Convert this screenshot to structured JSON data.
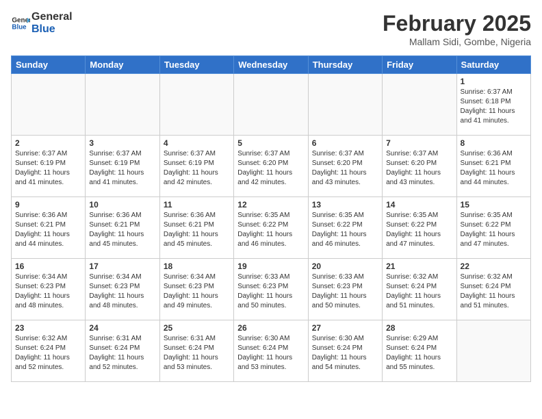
{
  "header": {
    "logo_line1": "General",
    "logo_line2": "Blue",
    "month_title": "February 2025",
    "location": "Mallam Sidi, Gombe, Nigeria"
  },
  "weekdays": [
    "Sunday",
    "Monday",
    "Tuesday",
    "Wednesday",
    "Thursday",
    "Friday",
    "Saturday"
  ],
  "weeks": [
    [
      {
        "day": "",
        "info": ""
      },
      {
        "day": "",
        "info": ""
      },
      {
        "day": "",
        "info": ""
      },
      {
        "day": "",
        "info": ""
      },
      {
        "day": "",
        "info": ""
      },
      {
        "day": "",
        "info": ""
      },
      {
        "day": "1",
        "info": "Sunrise: 6:37 AM\nSunset: 6:18 PM\nDaylight: 11 hours\nand 41 minutes."
      }
    ],
    [
      {
        "day": "2",
        "info": "Sunrise: 6:37 AM\nSunset: 6:19 PM\nDaylight: 11 hours\nand 41 minutes."
      },
      {
        "day": "3",
        "info": "Sunrise: 6:37 AM\nSunset: 6:19 PM\nDaylight: 11 hours\nand 41 minutes."
      },
      {
        "day": "4",
        "info": "Sunrise: 6:37 AM\nSunset: 6:19 PM\nDaylight: 11 hours\nand 42 minutes."
      },
      {
        "day": "5",
        "info": "Sunrise: 6:37 AM\nSunset: 6:20 PM\nDaylight: 11 hours\nand 42 minutes."
      },
      {
        "day": "6",
        "info": "Sunrise: 6:37 AM\nSunset: 6:20 PM\nDaylight: 11 hours\nand 43 minutes."
      },
      {
        "day": "7",
        "info": "Sunrise: 6:37 AM\nSunset: 6:20 PM\nDaylight: 11 hours\nand 43 minutes."
      },
      {
        "day": "8",
        "info": "Sunrise: 6:36 AM\nSunset: 6:21 PM\nDaylight: 11 hours\nand 44 minutes."
      }
    ],
    [
      {
        "day": "9",
        "info": "Sunrise: 6:36 AM\nSunset: 6:21 PM\nDaylight: 11 hours\nand 44 minutes."
      },
      {
        "day": "10",
        "info": "Sunrise: 6:36 AM\nSunset: 6:21 PM\nDaylight: 11 hours\nand 45 minutes."
      },
      {
        "day": "11",
        "info": "Sunrise: 6:36 AM\nSunset: 6:21 PM\nDaylight: 11 hours\nand 45 minutes."
      },
      {
        "day": "12",
        "info": "Sunrise: 6:35 AM\nSunset: 6:22 PM\nDaylight: 11 hours\nand 46 minutes."
      },
      {
        "day": "13",
        "info": "Sunrise: 6:35 AM\nSunset: 6:22 PM\nDaylight: 11 hours\nand 46 minutes."
      },
      {
        "day": "14",
        "info": "Sunrise: 6:35 AM\nSunset: 6:22 PM\nDaylight: 11 hours\nand 47 minutes."
      },
      {
        "day": "15",
        "info": "Sunrise: 6:35 AM\nSunset: 6:22 PM\nDaylight: 11 hours\nand 47 minutes."
      }
    ],
    [
      {
        "day": "16",
        "info": "Sunrise: 6:34 AM\nSunset: 6:23 PM\nDaylight: 11 hours\nand 48 minutes."
      },
      {
        "day": "17",
        "info": "Sunrise: 6:34 AM\nSunset: 6:23 PM\nDaylight: 11 hours\nand 48 minutes."
      },
      {
        "day": "18",
        "info": "Sunrise: 6:34 AM\nSunset: 6:23 PM\nDaylight: 11 hours\nand 49 minutes."
      },
      {
        "day": "19",
        "info": "Sunrise: 6:33 AM\nSunset: 6:23 PM\nDaylight: 11 hours\nand 50 minutes."
      },
      {
        "day": "20",
        "info": "Sunrise: 6:33 AM\nSunset: 6:23 PM\nDaylight: 11 hours\nand 50 minutes."
      },
      {
        "day": "21",
        "info": "Sunrise: 6:32 AM\nSunset: 6:24 PM\nDaylight: 11 hours\nand 51 minutes."
      },
      {
        "day": "22",
        "info": "Sunrise: 6:32 AM\nSunset: 6:24 PM\nDaylight: 11 hours\nand 51 minutes."
      }
    ],
    [
      {
        "day": "23",
        "info": "Sunrise: 6:32 AM\nSunset: 6:24 PM\nDaylight: 11 hours\nand 52 minutes."
      },
      {
        "day": "24",
        "info": "Sunrise: 6:31 AM\nSunset: 6:24 PM\nDaylight: 11 hours\nand 52 minutes."
      },
      {
        "day": "25",
        "info": "Sunrise: 6:31 AM\nSunset: 6:24 PM\nDaylight: 11 hours\nand 53 minutes."
      },
      {
        "day": "26",
        "info": "Sunrise: 6:30 AM\nSunset: 6:24 PM\nDaylight: 11 hours\nand 53 minutes."
      },
      {
        "day": "27",
        "info": "Sunrise: 6:30 AM\nSunset: 6:24 PM\nDaylight: 11 hours\nand 54 minutes."
      },
      {
        "day": "28",
        "info": "Sunrise: 6:29 AM\nSunset: 6:24 PM\nDaylight: 11 hours\nand 55 minutes."
      },
      {
        "day": "",
        "info": ""
      }
    ]
  ]
}
